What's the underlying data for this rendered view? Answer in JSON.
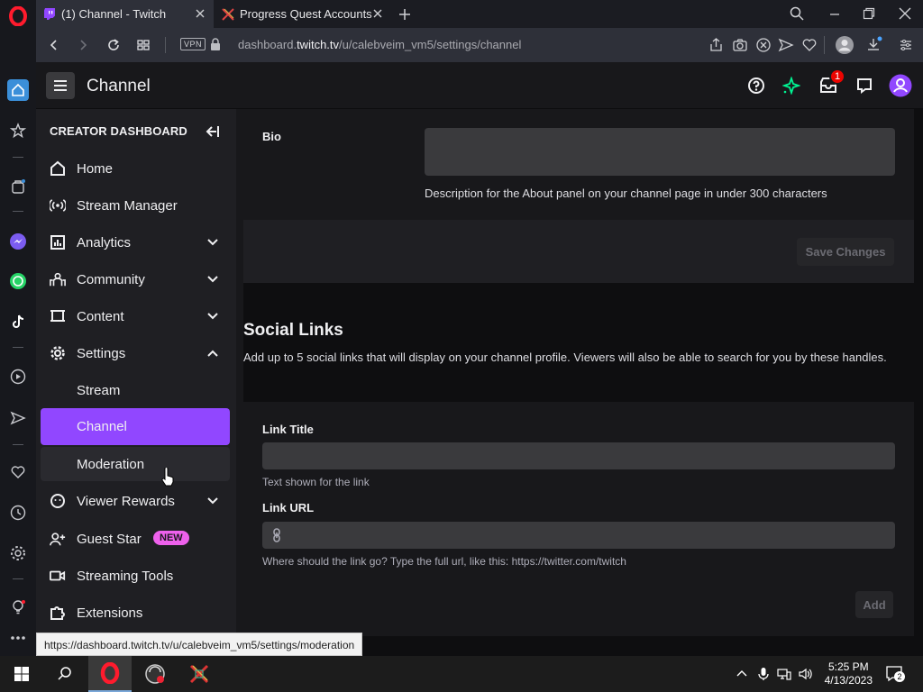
{
  "browser": {
    "tabs": [
      {
        "title": "(1) Channel - Twitch",
        "active": true
      },
      {
        "title": "Progress Quest Accounts",
        "active": false
      }
    ],
    "vpn_label": "VPN",
    "url_prefix": "dashboard.",
    "url_domain": "twitch.tv",
    "url_path": "/u/calebveim_vm5/settings/channel"
  },
  "twitch": {
    "page_title": "Channel",
    "notification_count": "1"
  },
  "sidebar": {
    "title": "CREATOR DASHBOARD",
    "items": [
      {
        "label": "Home"
      },
      {
        "label": "Stream Manager"
      },
      {
        "label": "Analytics"
      },
      {
        "label": "Community"
      },
      {
        "label": "Content"
      },
      {
        "label": "Settings"
      },
      {
        "label": "Stream"
      },
      {
        "label": "Channel"
      },
      {
        "label": "Moderation"
      },
      {
        "label": "Viewer Rewards"
      },
      {
        "label": "Guest Star"
      },
      {
        "label": "Streaming Tools"
      },
      {
        "label": "Extensions"
      }
    ],
    "new_badge": "NEW"
  },
  "main": {
    "bio_label": "Bio",
    "bio_value": "",
    "bio_helper": "Description for the About panel on your channel page in under 300 characters",
    "save_button": "Save Changes",
    "social_title": "Social Links",
    "social_desc": "Add up to 5 social links that will display on your channel profile. Viewers will also be able to search for you by these handles.",
    "link_title_label": "Link Title",
    "link_title_value": "",
    "link_title_helper": "Text shown for the link",
    "link_url_label": "Link URL",
    "link_url_value": "",
    "link_url_helper": "Where should the link go? Type the full url, like this: https://twitter.com/twitch",
    "add_button": "Add"
  },
  "status_url": "https://dashboard.twitch.tv/u/calebveim_vm5/settings/moderation",
  "taskbar": {
    "time": "5:25 PM",
    "date": "4/13/2023",
    "notification_count": "2"
  },
  "colors": {
    "accent": "#9147ff",
    "opera_red": "#ff1b2d",
    "badge_pink": "#ee61ec"
  }
}
